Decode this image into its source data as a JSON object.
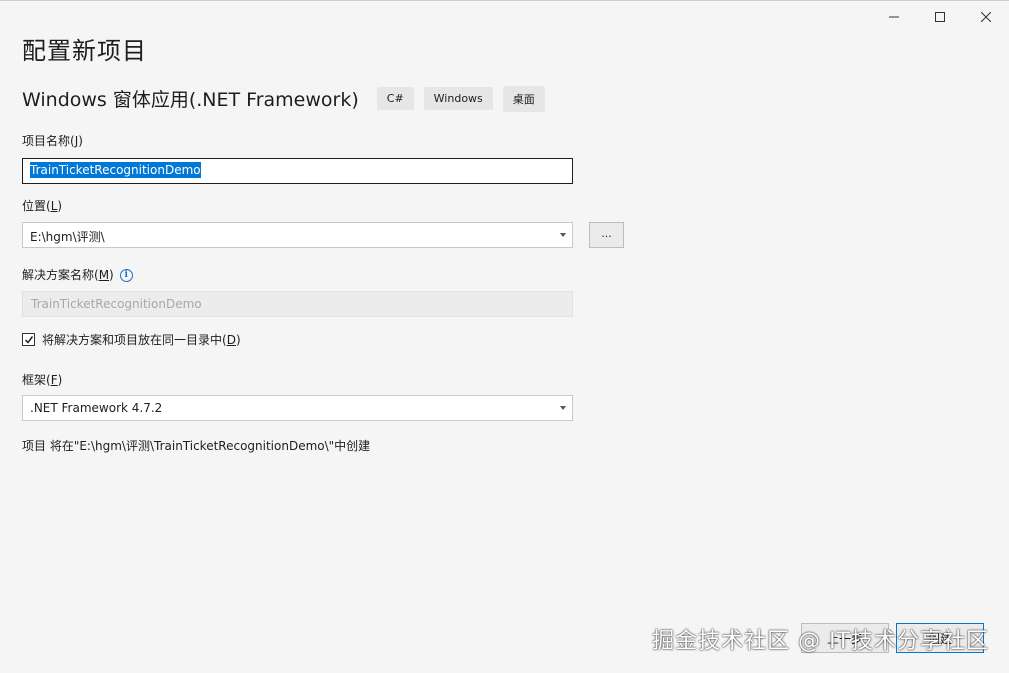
{
  "window": {
    "minimize_symbol": "—",
    "maximize_symbol": "☐",
    "close_symbol": "✕"
  },
  "page_title": "配置新项目",
  "template": {
    "name": "Windows 窗体应用(.NET Framework)",
    "tags": [
      "C#",
      "Windows",
      "桌面"
    ]
  },
  "project_name": {
    "label_prefix": "项目名称(",
    "label_key": "J",
    "label_suffix": ")",
    "value": "TrainTicketRecognitionDemo"
  },
  "location": {
    "label_prefix": "位置(",
    "label_key": "L",
    "label_suffix": ")",
    "value": "E:\\hgm\\评测\\",
    "browse_label": "..."
  },
  "solution_name": {
    "label_prefix": "解决方案名称(",
    "label_key": "M",
    "label_suffix": ")",
    "info_icon": "i",
    "placeholder": "TrainTicketRecognitionDemo"
  },
  "same_directory": {
    "checked": true,
    "label_prefix": "将解决方案和项目放在同一目录中(",
    "label_key": "D",
    "label_suffix": ")"
  },
  "framework": {
    "label_prefix": "框架(",
    "label_key": "F",
    "label_suffix": ")",
    "value": ".NET Framework 4.7.2"
  },
  "path_info": "项目 将在\"E:\\hgm\\评测\\TrainTicketRecognitionDemo\\\"中创建",
  "footer": {
    "back_label": "上一步",
    "create_label": "创建"
  },
  "watermark": "掘金技术社区 @ IT技术分享社区"
}
